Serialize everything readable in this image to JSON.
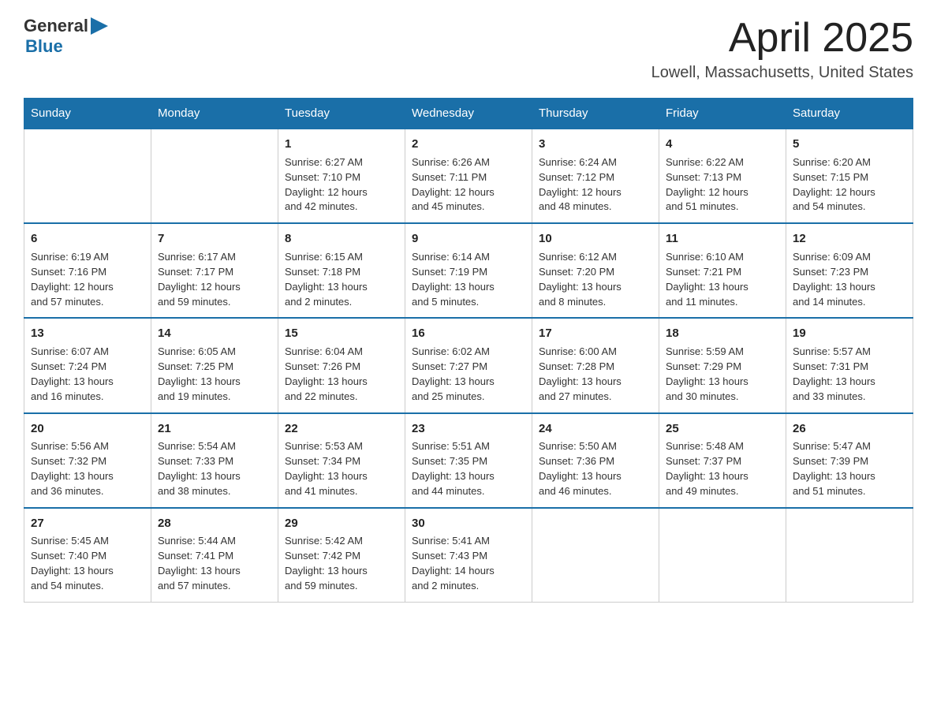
{
  "header": {
    "logo": {
      "text_general": "General",
      "text_blue": "Blue"
    },
    "title": "April 2025",
    "location": "Lowell, Massachusetts, United States"
  },
  "calendar": {
    "days_of_week": [
      "Sunday",
      "Monday",
      "Tuesday",
      "Wednesday",
      "Thursday",
      "Friday",
      "Saturday"
    ],
    "weeks": [
      [
        {
          "day": "",
          "info": ""
        },
        {
          "day": "",
          "info": ""
        },
        {
          "day": "1",
          "info": "Sunrise: 6:27 AM\nSunset: 7:10 PM\nDaylight: 12 hours\nand 42 minutes."
        },
        {
          "day": "2",
          "info": "Sunrise: 6:26 AM\nSunset: 7:11 PM\nDaylight: 12 hours\nand 45 minutes."
        },
        {
          "day": "3",
          "info": "Sunrise: 6:24 AM\nSunset: 7:12 PM\nDaylight: 12 hours\nand 48 minutes."
        },
        {
          "day": "4",
          "info": "Sunrise: 6:22 AM\nSunset: 7:13 PM\nDaylight: 12 hours\nand 51 minutes."
        },
        {
          "day": "5",
          "info": "Sunrise: 6:20 AM\nSunset: 7:15 PM\nDaylight: 12 hours\nand 54 minutes."
        }
      ],
      [
        {
          "day": "6",
          "info": "Sunrise: 6:19 AM\nSunset: 7:16 PM\nDaylight: 12 hours\nand 57 minutes."
        },
        {
          "day": "7",
          "info": "Sunrise: 6:17 AM\nSunset: 7:17 PM\nDaylight: 12 hours\nand 59 minutes."
        },
        {
          "day": "8",
          "info": "Sunrise: 6:15 AM\nSunset: 7:18 PM\nDaylight: 13 hours\nand 2 minutes."
        },
        {
          "day": "9",
          "info": "Sunrise: 6:14 AM\nSunset: 7:19 PM\nDaylight: 13 hours\nand 5 minutes."
        },
        {
          "day": "10",
          "info": "Sunrise: 6:12 AM\nSunset: 7:20 PM\nDaylight: 13 hours\nand 8 minutes."
        },
        {
          "day": "11",
          "info": "Sunrise: 6:10 AM\nSunset: 7:21 PM\nDaylight: 13 hours\nand 11 minutes."
        },
        {
          "day": "12",
          "info": "Sunrise: 6:09 AM\nSunset: 7:23 PM\nDaylight: 13 hours\nand 14 minutes."
        }
      ],
      [
        {
          "day": "13",
          "info": "Sunrise: 6:07 AM\nSunset: 7:24 PM\nDaylight: 13 hours\nand 16 minutes."
        },
        {
          "day": "14",
          "info": "Sunrise: 6:05 AM\nSunset: 7:25 PM\nDaylight: 13 hours\nand 19 minutes."
        },
        {
          "day": "15",
          "info": "Sunrise: 6:04 AM\nSunset: 7:26 PM\nDaylight: 13 hours\nand 22 minutes."
        },
        {
          "day": "16",
          "info": "Sunrise: 6:02 AM\nSunset: 7:27 PM\nDaylight: 13 hours\nand 25 minutes."
        },
        {
          "day": "17",
          "info": "Sunrise: 6:00 AM\nSunset: 7:28 PM\nDaylight: 13 hours\nand 27 minutes."
        },
        {
          "day": "18",
          "info": "Sunrise: 5:59 AM\nSunset: 7:29 PM\nDaylight: 13 hours\nand 30 minutes."
        },
        {
          "day": "19",
          "info": "Sunrise: 5:57 AM\nSunset: 7:31 PM\nDaylight: 13 hours\nand 33 minutes."
        }
      ],
      [
        {
          "day": "20",
          "info": "Sunrise: 5:56 AM\nSunset: 7:32 PM\nDaylight: 13 hours\nand 36 minutes."
        },
        {
          "day": "21",
          "info": "Sunrise: 5:54 AM\nSunset: 7:33 PM\nDaylight: 13 hours\nand 38 minutes."
        },
        {
          "day": "22",
          "info": "Sunrise: 5:53 AM\nSunset: 7:34 PM\nDaylight: 13 hours\nand 41 minutes."
        },
        {
          "day": "23",
          "info": "Sunrise: 5:51 AM\nSunset: 7:35 PM\nDaylight: 13 hours\nand 44 minutes."
        },
        {
          "day": "24",
          "info": "Sunrise: 5:50 AM\nSunset: 7:36 PM\nDaylight: 13 hours\nand 46 minutes."
        },
        {
          "day": "25",
          "info": "Sunrise: 5:48 AM\nSunset: 7:37 PM\nDaylight: 13 hours\nand 49 minutes."
        },
        {
          "day": "26",
          "info": "Sunrise: 5:47 AM\nSunset: 7:39 PM\nDaylight: 13 hours\nand 51 minutes."
        }
      ],
      [
        {
          "day": "27",
          "info": "Sunrise: 5:45 AM\nSunset: 7:40 PM\nDaylight: 13 hours\nand 54 minutes."
        },
        {
          "day": "28",
          "info": "Sunrise: 5:44 AM\nSunset: 7:41 PM\nDaylight: 13 hours\nand 57 minutes."
        },
        {
          "day": "29",
          "info": "Sunrise: 5:42 AM\nSunset: 7:42 PM\nDaylight: 13 hours\nand 59 minutes."
        },
        {
          "day": "30",
          "info": "Sunrise: 5:41 AM\nSunset: 7:43 PM\nDaylight: 14 hours\nand 2 minutes."
        },
        {
          "day": "",
          "info": ""
        },
        {
          "day": "",
          "info": ""
        },
        {
          "day": "",
          "info": ""
        }
      ]
    ]
  }
}
